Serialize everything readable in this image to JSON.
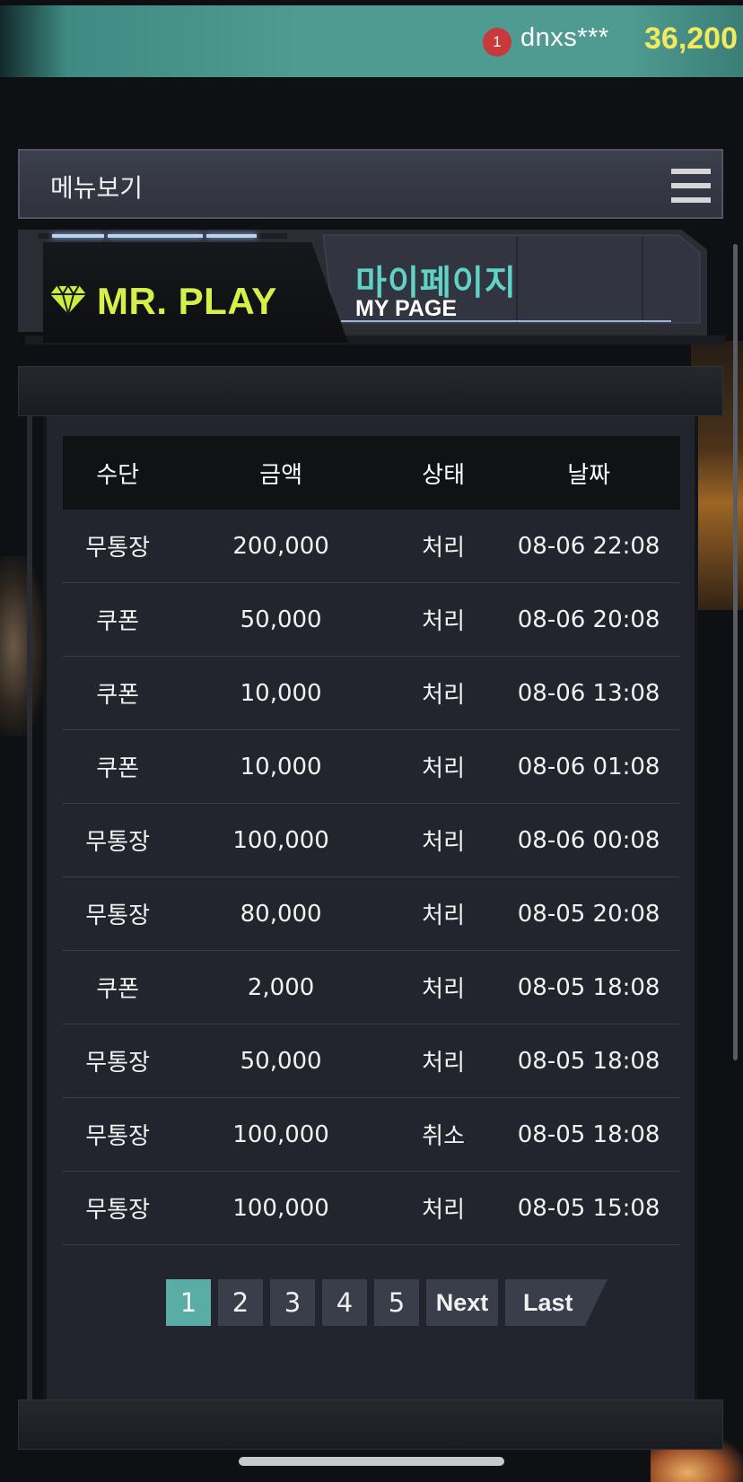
{
  "topbar": {
    "notification_count": "1",
    "username": "dnxs***",
    "balance": "36,200"
  },
  "menu": {
    "label": "메뉴보기",
    "icon": "hamburger-menu-icon"
  },
  "header": {
    "brand": "MR. PLAY",
    "brand_icon": "diamond-icon",
    "title_ko": "마이페이지",
    "title_en": "MY PAGE"
  },
  "table": {
    "columns": [
      "수단",
      "금액",
      "상태",
      "날짜"
    ],
    "rows": [
      [
        "무통장",
        "200,000",
        "처리",
        "08-06 22:08"
      ],
      [
        "쿠폰",
        "50,000",
        "처리",
        "08-06 20:08"
      ],
      [
        "쿠폰",
        "10,000",
        "처리",
        "08-06 13:08"
      ],
      [
        "쿠폰",
        "10,000",
        "처리",
        "08-06 01:08"
      ],
      [
        "무통장",
        "100,000",
        "처리",
        "08-06 00:08"
      ],
      [
        "무통장",
        "80,000",
        "처리",
        "08-05 20:08"
      ],
      [
        "쿠폰",
        "2,000",
        "처리",
        "08-05 18:08"
      ],
      [
        "무통장",
        "50,000",
        "처리",
        "08-05 18:08"
      ],
      [
        "무통장",
        "100,000",
        "취소",
        "08-05 18:08"
      ],
      [
        "무통장",
        "100,000",
        "처리",
        "08-05 15:08"
      ]
    ]
  },
  "pagination": {
    "pages": [
      "1",
      "2",
      "3",
      "4",
      "5"
    ],
    "current": "1",
    "next_label": "Next",
    "last_label": "Last"
  },
  "colors": {
    "accent": "#5aada4",
    "brand": "#d6f04a",
    "title": "#5fd4c6",
    "balance": "#f2ea5c",
    "badge": "#c8393b"
  }
}
